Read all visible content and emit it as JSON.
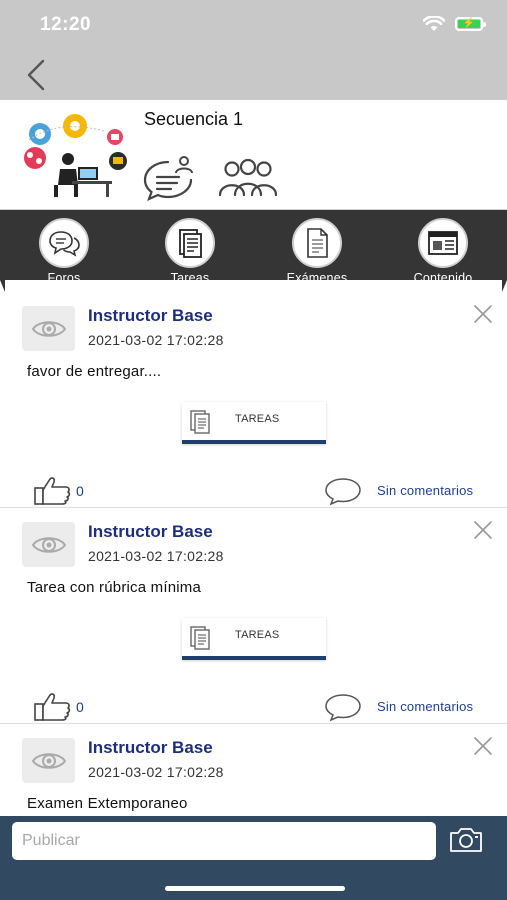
{
  "status_bar": {
    "time": "12:20"
  },
  "course": {
    "title": "Secuencia 1"
  },
  "tabs": [
    {
      "label": "Foros",
      "icon": "chat-bubbles-icon"
    },
    {
      "label": "Tareas",
      "icon": "task-document-icon"
    },
    {
      "label": "Exámenes",
      "icon": "exam-document-icon"
    },
    {
      "label": "Contenido",
      "icon": "content-page-icon"
    }
  ],
  "posts": [
    {
      "author": "Instructor Base",
      "date": "2021-03-02 17:02:28",
      "body": "favor de entregar....",
      "attachment": "TAREAS",
      "likes": "0",
      "comments": "Sin comentarios"
    },
    {
      "author": "Instructor Base",
      "date": "2021-03-02 17:02:28",
      "body": "Tarea con rúbrica mínima",
      "attachment": "TAREAS",
      "likes": "0",
      "comments": "Sin comentarios"
    },
    {
      "author": "Instructor Base",
      "date": "2021-03-02 17:02:28",
      "body": "Examen Extemporaneo",
      "attachment": "",
      "likes": "",
      "comments": ""
    }
  ],
  "composer": {
    "placeholder": "Publicar",
    "value": ""
  },
  "colors": {
    "topbar": "#c8c8c8",
    "tabbar": "#353535",
    "author": "#1e2e7a",
    "link": "#1f3f8a",
    "composer": "#324962",
    "battery": "#39d353"
  }
}
